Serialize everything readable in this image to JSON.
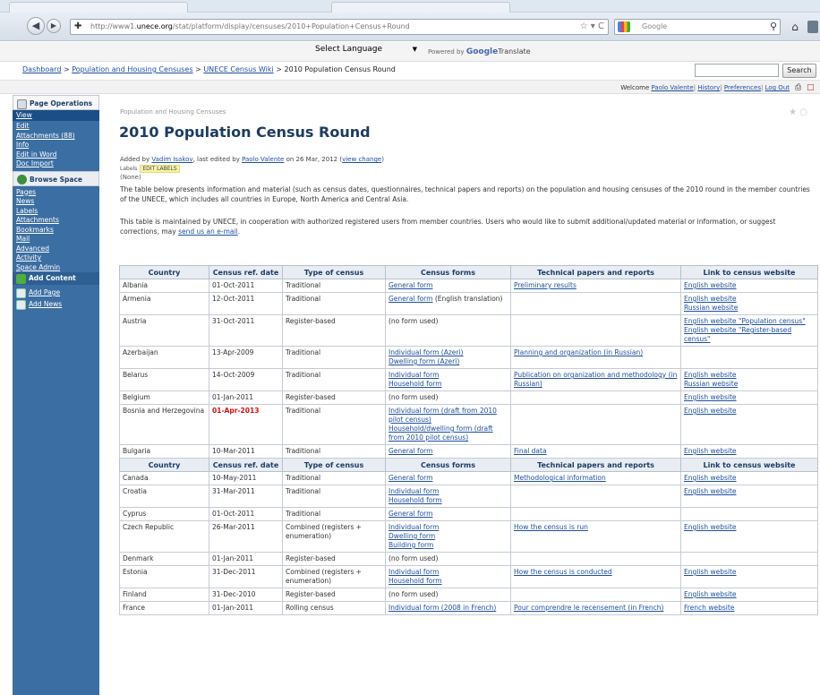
{
  "browser": {
    "url_prefix": "http://www1.",
    "url_domain": "unece.org",
    "url_path": "/stat/platform/display/censuses/2010+Population+Census+Round",
    "search_engine": "Google",
    "back_icon": "back-arrow",
    "forward_icon": "forward-arrow"
  },
  "translate": {
    "select_language": "Select Language",
    "powered_by": "Powered by",
    "google": "Google",
    "translate": "Translate"
  },
  "breadcrumb": [
    {
      "label": "Dashboard",
      "link": true
    },
    {
      "label": "Population and Housing Censuses",
      "link": true
    },
    {
      "label": "UNECE Census Wiki",
      "link": true
    },
    {
      "label": "2010 Population Census Round",
      "link": false
    }
  ],
  "search_button": "Search",
  "user": {
    "welcome": "Welcome",
    "name": "Paolo Valente",
    "history": "History",
    "preferences": "Preferences",
    "logout": "Log Out"
  },
  "sidebar": {
    "page_operations": "Page Operations",
    "view": "View",
    "page_items": [
      "Edit",
      "Attachments (88)",
      "Info",
      "Edit in Word",
      "Doc Import"
    ],
    "browse_space": "Browse Space",
    "browse_items": [
      "Pages",
      "News",
      "Labels",
      "Attachments",
      "Bookmarks",
      "Mail",
      "Advanced",
      "Activity",
      "Space Admin"
    ],
    "add_content": "Add Content",
    "add_items": [
      "Add Page",
      "Add News"
    ]
  },
  "page": {
    "space": "Population and Housing Censuses",
    "title": "2010 Population Census Round",
    "added_by": "Added by",
    "author": "Vadim Isakov",
    "last_edited_by": ", last edited by",
    "editor": "Paolo Valente",
    "edited_on": "on 26 Mar, 2012",
    "view_change": "view change",
    "labels": "Labels",
    "edit_labels": "EDIT LABELS",
    "none": "(None)",
    "p1": "The table below presents information and material (such as census dates, questionnaires, technical papers and reports) on the population and housing censuses of the 2010 round in the member countries of the UNECE, which includes all countries in Europe, North America and Central Asia.",
    "p2_a": "This table is maintained by UNECE, in cooperation with authorized registered users from member countries.  Users who would like to submit additional/updated material or information, or suggest corrections, may",
    "p2_link": "send us an e-mail",
    "p2_b": "."
  },
  "table": {
    "headers": [
      "Country",
      "Census ref. date",
      "Type of census",
      "Census forms",
      "Technical papers and reports",
      "Link to census website"
    ],
    "rows": [
      {
        "country": "Albania",
        "date": "01-Oct-2011",
        "type": "Traditional",
        "forms": [
          "General form"
        ],
        "papers": [
          "Preliminary results"
        ],
        "links": [
          "English website"
        ]
      },
      {
        "country": "Armenia",
        "date": "12-Oct-2011",
        "type": "Traditional",
        "forms": [
          "General form"
        ],
        "forms_note": " (English translation)",
        "papers": [],
        "links": [
          "English website",
          "Russian website"
        ]
      },
      {
        "country": "Austria",
        "date": "31-Oct-2011",
        "type": "Register-based",
        "forms_text": "(no form used)",
        "forms": [],
        "papers": [],
        "links": [
          "English website \"Population census\"",
          "English website \"Register-based census\""
        ]
      },
      {
        "country": "Azerbaijan",
        "date": "13-Apr-2009",
        "type": "Traditional",
        "forms": [
          "Individual form (Azeri)",
          "Dwelling form (Azeri)"
        ],
        "papers": [
          "Planning and organization (in Russian)"
        ],
        "links": []
      },
      {
        "country": "Belarus",
        "date": "14-Oct-2009",
        "type": "Traditional",
        "forms": [
          "Individual form",
          "Household form"
        ],
        "papers": [
          "Publication on organization and methodology (in Russian)"
        ],
        "links": [
          "English website",
          "Russian website"
        ]
      },
      {
        "country": "Belgium",
        "date": "01-Jan-2011",
        "type": "Register-based",
        "forms_text": "(no form used)",
        "forms": [],
        "papers": [],
        "links": [
          "English website"
        ]
      },
      {
        "country": "Bosnia and Herzegovina",
        "date": "01-Apr-2013",
        "date_red": true,
        "type": "Traditional",
        "forms": [
          "Individual form (draft from 2010 pilot census)",
          "Household/dwelling form (draft from 2010 pilot census)"
        ],
        "papers": [],
        "links": [
          "English website"
        ]
      },
      {
        "country": "Bulgaria",
        "date": "10-Mar-2011",
        "type": "Traditional",
        "forms": [
          "General form"
        ],
        "papers": [
          "Final data"
        ],
        "links": [
          "English website"
        ]
      },
      {
        "header": true
      },
      {
        "country": "Canada",
        "date": "10-May-2011",
        "type": "Traditional",
        "forms": [
          "General form"
        ],
        "papers": [
          "Methodological information"
        ],
        "links": [
          "English website"
        ]
      },
      {
        "country": "Croatia",
        "date": "31-Mar-2011",
        "type": "Traditional",
        "forms": [
          "Individual form",
          "Household form"
        ],
        "papers": [],
        "links": [
          "English website"
        ]
      },
      {
        "country": "Cyprus",
        "date": "01-Oct-2011",
        "type": "Traditional",
        "forms": [
          "General form"
        ],
        "papers": [],
        "links": []
      },
      {
        "country": "Czech Republic",
        "date": "26-Mar-2011",
        "type": "Combined (registers + enumeration)",
        "forms": [
          "Individual form",
          "Dwelling form",
          "Building form"
        ],
        "papers": [
          "How the census is run"
        ],
        "links": [
          "English website"
        ]
      },
      {
        "country": "Denmark",
        "date": "01-Jan-2011",
        "type": "Register-based",
        "forms_text": "(no form used)",
        "forms": [],
        "papers": [],
        "links": []
      },
      {
        "country": "Estonia",
        "date": "31-Dec-2011",
        "type": "Combined (registers + enumeration)",
        "forms": [
          "Individual form",
          "Household form"
        ],
        "papers": [
          "How the census is conducted"
        ],
        "links": [
          "English website"
        ]
      },
      {
        "country": "Finland",
        "date": "31-Dec-2010",
        "type": "Register-based",
        "forms_text": "(no form used)",
        "forms": [],
        "papers": [],
        "links": [
          "English website"
        ]
      },
      {
        "country": "France",
        "date": "01-Jan-2011",
        "type": "Rolling census",
        "forms": [
          "Individual form (2008 in French)"
        ],
        "papers": [
          "Pour comprendre le recensement (in French)"
        ],
        "links": [
          "French website"
        ]
      }
    ]
  }
}
